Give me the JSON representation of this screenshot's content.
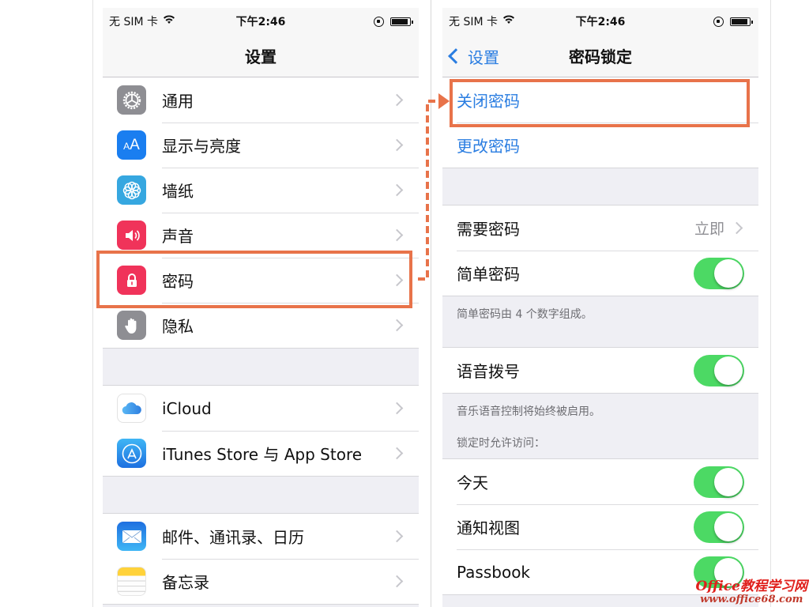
{
  "left_screen": {
    "status": {
      "carrier": "无 SIM 卡",
      "time": "下午2:46"
    },
    "nav_title": "设置",
    "groups": [
      [
        {
          "label": "通用",
          "icon": "gear-icon",
          "color": "#8e8e93"
        },
        {
          "label": "显示与亮度",
          "icon": "text-size-icon",
          "color": "#1a7ef0"
        },
        {
          "label": "墙纸",
          "icon": "flower-icon",
          "color": "#36a7e0"
        },
        {
          "label": "声音",
          "icon": "speaker-icon",
          "color": "#f0335a"
        },
        {
          "label": "密码",
          "icon": "lock-icon",
          "color": "#f0335a"
        },
        {
          "label": "隐私",
          "icon": "hand-icon",
          "color": "#8e8e93"
        }
      ],
      [
        {
          "label": "iCloud",
          "icon": "cloud-icon",
          "color": "#ffffff"
        },
        {
          "label": "iTunes Store 与 App Store",
          "icon": "app-store-icon",
          "color": "#2a8ff0"
        }
      ],
      [
        {
          "label": "邮件、通讯录、日历",
          "icon": "mail-icon",
          "color": "#2a8ff0"
        },
        {
          "label": "备忘录",
          "icon": "notes-icon",
          "color": "#ffffff"
        }
      ]
    ]
  },
  "right_screen": {
    "status": {
      "carrier": "无 SIM 卡",
      "time": "下午2:46"
    },
    "back_label": "设置",
    "nav_title": "密码锁定",
    "passcode_actions": [
      "关闭密码",
      "更改密码"
    ],
    "require_passcode": {
      "label": "需要密码",
      "value": "立即"
    },
    "simple_passcode": {
      "label": "简单密码",
      "on": true
    },
    "simple_note": "简单密码由 4 个数字组成。",
    "voice_dial": {
      "label": "语音拨号",
      "on": true
    },
    "voice_note": "音乐语音控制将始终被启用。",
    "lock_access_header": "锁定时允许访问：",
    "lock_access_items": [
      {
        "label": "今天",
        "on": true
      },
      {
        "label": "通知视图",
        "on": true
      },
      {
        "label": "Passbook",
        "on": true
      }
    ]
  },
  "annotation": {
    "color": "#e8734a"
  },
  "watermark": {
    "line1": "Office教程学习网",
    "line2": "www.office68.com"
  }
}
